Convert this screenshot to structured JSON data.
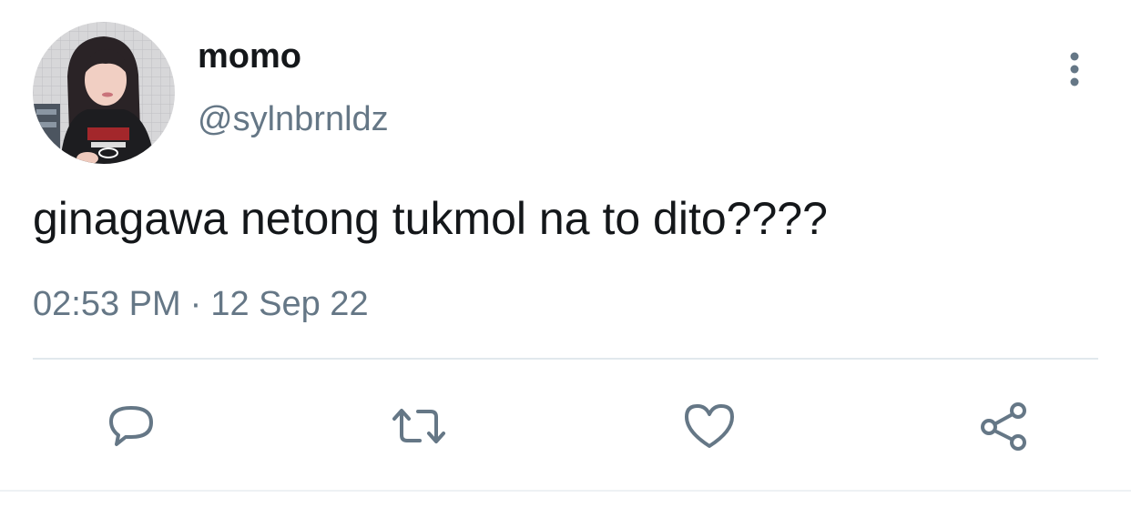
{
  "user": {
    "display_name": "momo",
    "handle": "@sylnbrnldz",
    "avatar": "profile-photo"
  },
  "tweet": {
    "text": "ginagawa netong tukmol na to dito????",
    "time": "02:53 PM",
    "separator": "·",
    "date": "12 Sep 22"
  },
  "actions": {
    "reply_icon": "speech-bubble-icon",
    "retweet_icon": "retweet-arrows-icon",
    "like_icon": "heart-icon",
    "share_icon": "share-nodes-icon",
    "more_icon": "vertical-dots-icon"
  },
  "colors": {
    "text_primary": "#14171a",
    "text_secondary": "#657786",
    "divider": "#e1e8ed",
    "icon": "#657786"
  }
}
